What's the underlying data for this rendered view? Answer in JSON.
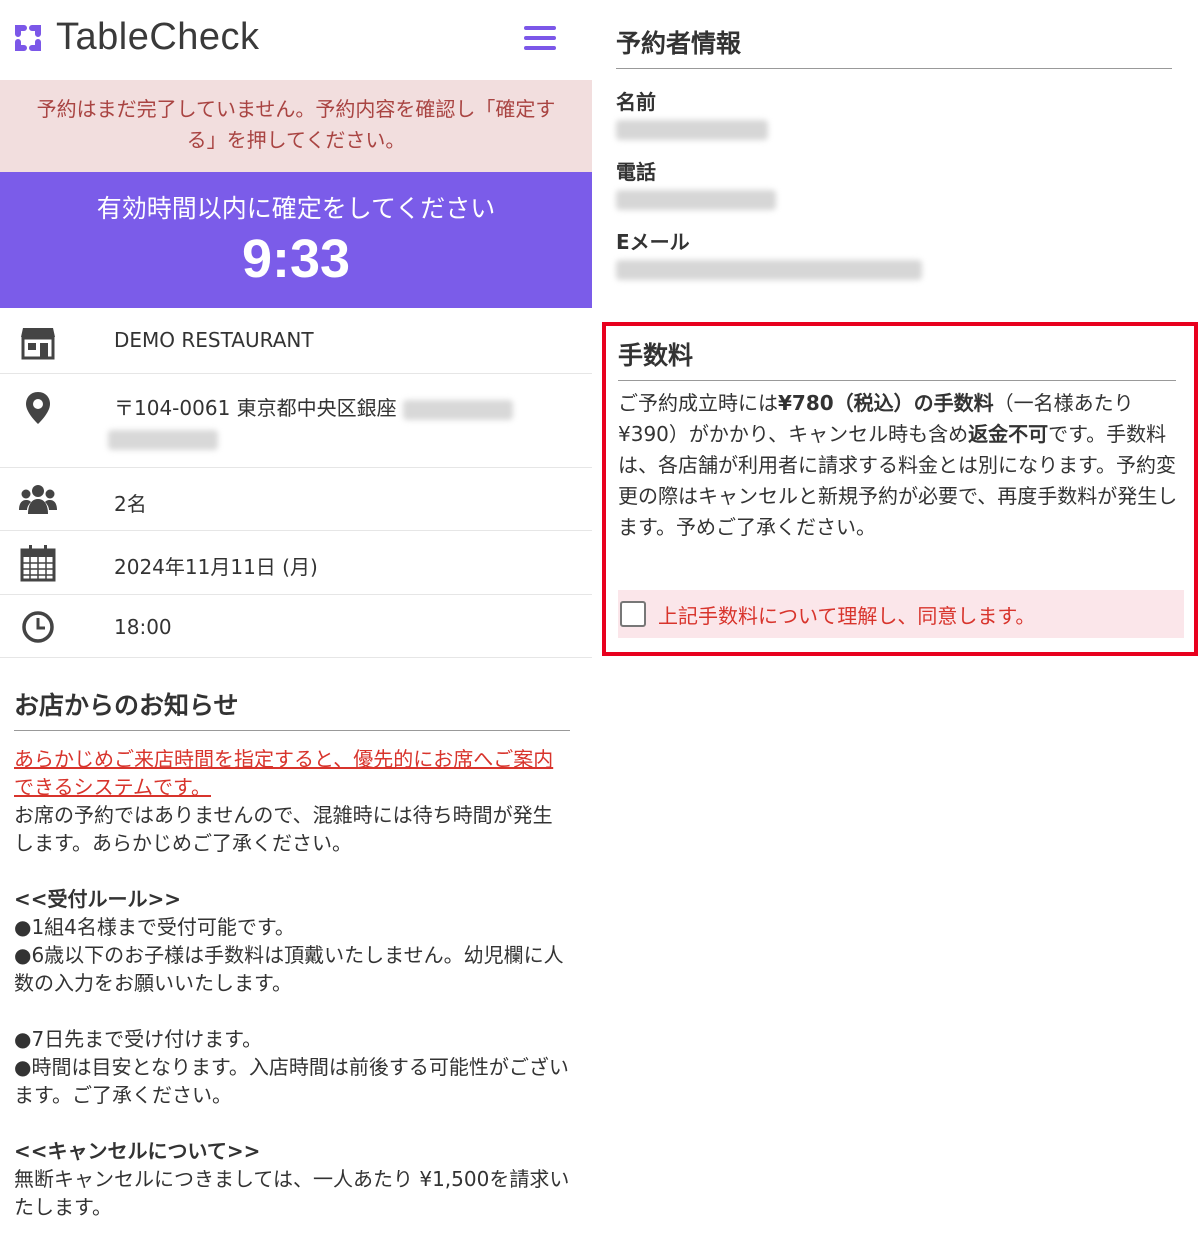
{
  "header": {
    "logo_text": "TableCheck",
    "menu_icon": "hamburger-menu-icon",
    "accent_color": "#7b57e8"
  },
  "warning": {
    "line1": "予約はまだ完了していません。予約内容を確認し「確定す",
    "line2": "る」を押してください。"
  },
  "timer": {
    "message": "有効時間以内に確定をしてください",
    "countdown": "9:33"
  },
  "reservation": {
    "restaurant": "DEMO RESTAURANT",
    "address_prefix": "〒104-0061 東京都中央区銀座",
    "party_size": "2名",
    "date": "2024年11月11日 (月)",
    "time": "18:00",
    "icons": [
      "store-icon",
      "map-pin-icon",
      "users-icon",
      "calendar-icon",
      "clock-icon"
    ]
  },
  "notice": {
    "title": "お店からのお知らせ",
    "highlight": "あらかじめご来店時間を指定すると、優先的にお席へご案内できるシステムです。",
    "intro": "お席の予約ではありませんので、混雑時には待ち時間が発生します。あらかじめご了承ください。",
    "rules_heading": "<<受付ルール>>",
    "rule1": "●1組4名様まで受付可能です。",
    "rule2": "●6歳以下のお子様は手数料は頂戴いたしません。幼児欄に人数の入力をお願いいたします。",
    "rule3": "●7日先まで受け付けます。",
    "rule4": "●時間は目安となります。入店時間は前後する可能性がございます。ご了承ください。",
    "cancel_heading": "<<キャンセルについて>>",
    "cancel_text": "無断キャンセルにつきましては、一人あたり ¥1,500を請求いたします。"
  },
  "booker": {
    "title": "予約者情報",
    "name_label": "名前",
    "phone_label": "電話",
    "email_label": "Eメール"
  },
  "fee": {
    "title": "手数料",
    "text_a": "ご予約成立時には",
    "text_b": "¥780（税込）の手数料",
    "text_c": "（一名様あたり ¥390）がかかり、キャンセル時も含め",
    "text_d": "返金不可",
    "text_e": "です。手数料は、各店舗が利用者に請求する料金とは別になります。予約変更の際はキャンセルと新規予約が必要で、再度手数料が発生します。予めご了承ください。",
    "agree_label": "上記手数料について理解し、同意します。",
    "highlight_color": "#e8001e"
  }
}
